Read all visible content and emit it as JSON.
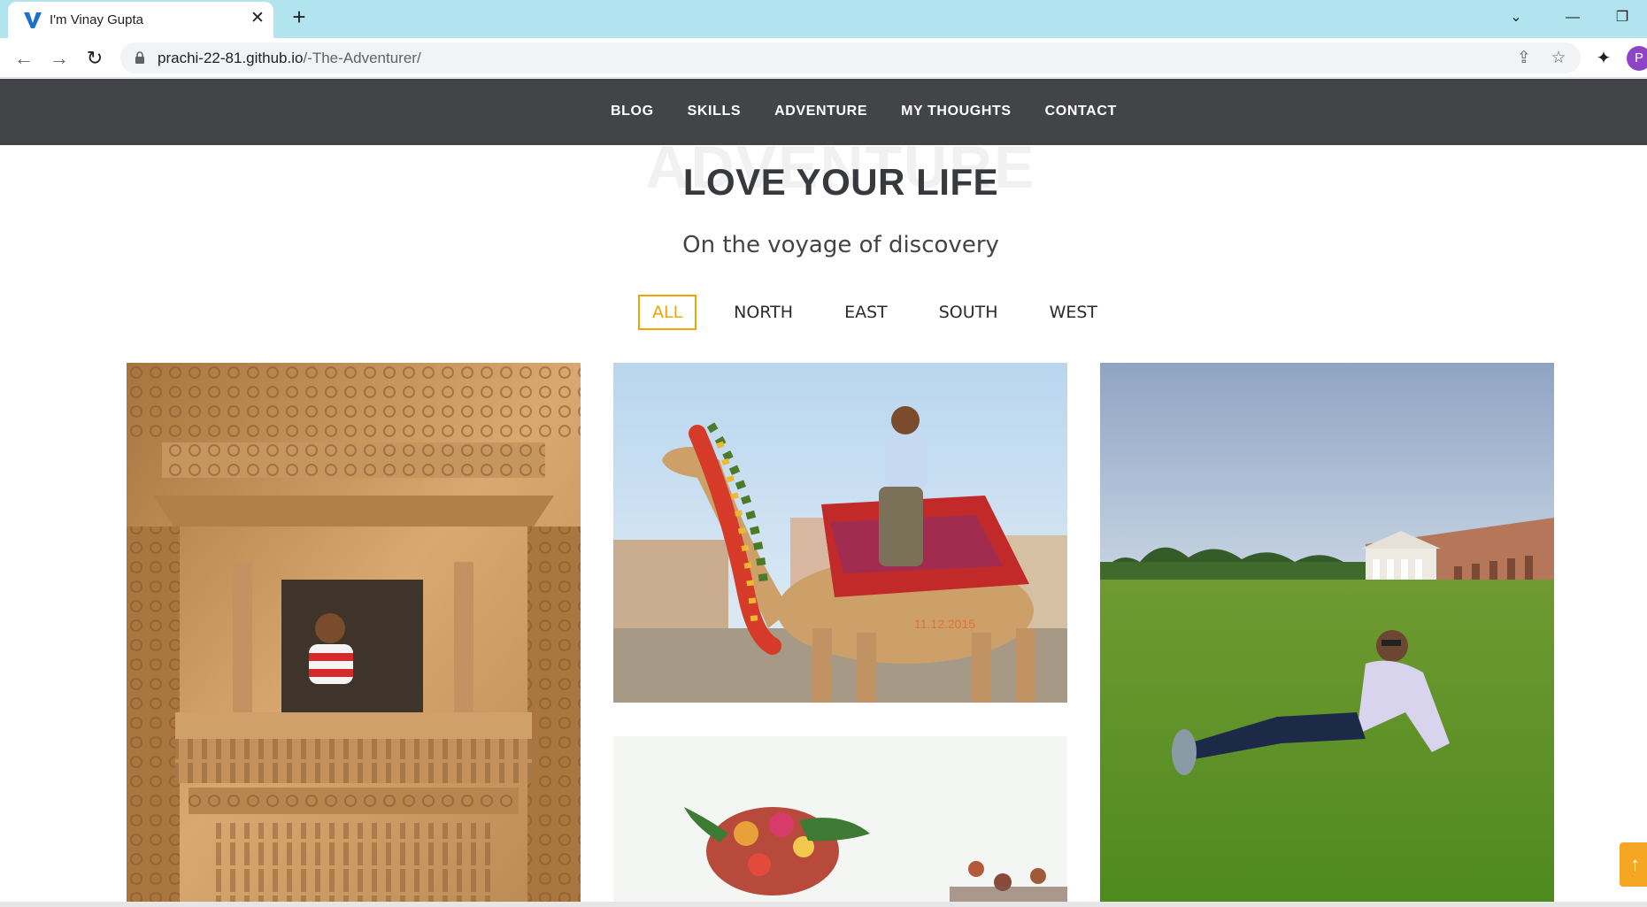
{
  "browser": {
    "tab_title": "I'm Vinay Gupta",
    "close_glyph": "✕",
    "newtab_glyph": "+",
    "url_host": "prachi-22-81.github.io",
    "url_path": "/-The-Adventurer/",
    "profile_initial": "P",
    "window_controls": {
      "tabsearch": "⌄",
      "minimize": "—",
      "restore": "❐"
    },
    "nav_icons": {
      "back": "←",
      "forward": "→",
      "reload": "↻"
    },
    "omnibox_icons": {
      "share": "⇪",
      "bookmark": "☆"
    },
    "extensions_icon": "✦"
  },
  "nav": {
    "items": [
      {
        "label": "BLOG"
      },
      {
        "label": "SKILLS"
      },
      {
        "label": "ADVENTURE"
      },
      {
        "label": "MY THOUGHTS"
      },
      {
        "label": "CONTACT"
      }
    ]
  },
  "section": {
    "background_word": "ADVENTURE",
    "title": "LOVE YOUR LIFE",
    "subtitle": "On the voyage of discovery"
  },
  "filters": {
    "items": [
      {
        "label": "ALL",
        "active": true
      },
      {
        "label": "NORTH"
      },
      {
        "label": "EAST"
      },
      {
        "label": "SOUTH"
      },
      {
        "label": "WEST"
      }
    ]
  },
  "gallery": {
    "photos": [
      {
        "alt": "Man in carved stepwell window"
      },
      {
        "alt": "Man riding decorated camel"
      },
      {
        "alt": "Flower decoration"
      },
      {
        "alt": "Man sitting on lawn before colonial building"
      }
    ],
    "camel_photo_date": "11.12.2015"
  },
  "colors": {
    "accent": "#f0a500",
    "navbar": "#434448",
    "tabbar": "#b2e4f0"
  },
  "scroll_top": {
    "glyph": "↑"
  }
}
